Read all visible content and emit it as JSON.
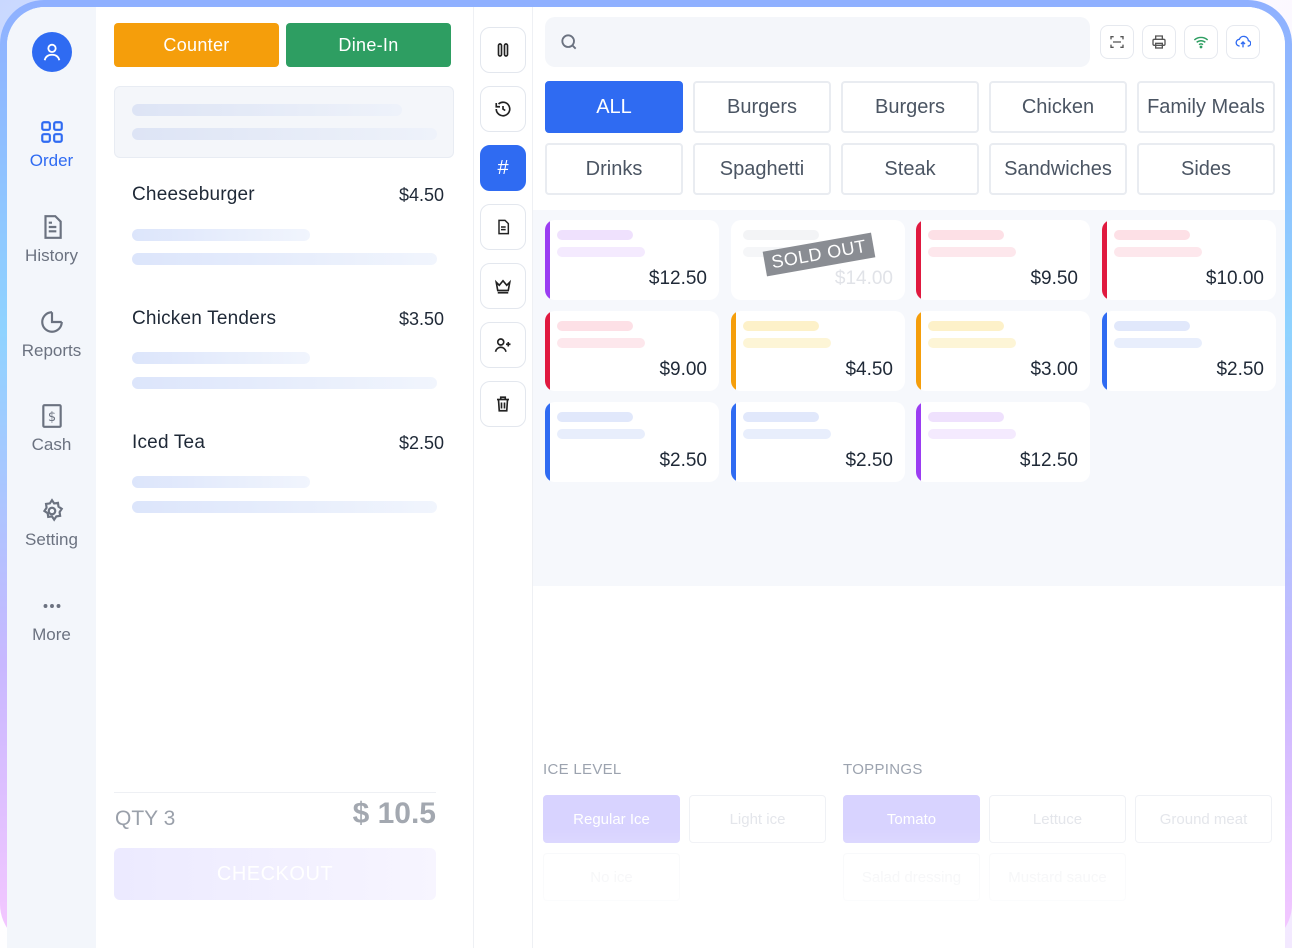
{
  "nav": {
    "items": [
      {
        "label": "Order",
        "icon": "grid-icon",
        "active": true
      },
      {
        "label": "History",
        "icon": "document-icon",
        "active": false
      },
      {
        "label": "Reports",
        "icon": "pie-chart-icon",
        "active": false
      },
      {
        "label": "Cash",
        "icon": "cash-receipt-icon",
        "active": false
      },
      {
        "label": "Setting",
        "icon": "gear-icon",
        "active": false
      },
      {
        "label": "More",
        "icon": "more-dots-icon",
        "active": false
      }
    ]
  },
  "order": {
    "mode_counter": "Counter",
    "mode_dine_in": "Dine-In",
    "items": [
      {
        "name": "Cheeseburger",
        "price": "$4.50"
      },
      {
        "name": "Chicken Tenders",
        "price": "$3.50"
      },
      {
        "name": "Iced Tea",
        "price": "$2.50"
      }
    ],
    "qty_label": "QTY 3",
    "total": "$ 10.5",
    "checkout_label": "CHECKOUT"
  },
  "tools": [
    "pause-icon",
    "history-icon",
    "hash-icon",
    "note-icon",
    "crown-icon",
    "add-user-icon",
    "trash-icon"
  ],
  "search": {
    "placeholder": ""
  },
  "categories": [
    "ALL",
    "Burgers",
    "Burgers",
    "Chicken",
    "Family Meals",
    "Drinks",
    "Spaghetti",
    "Steak",
    "Sandwiches",
    "Sides"
  ],
  "products": [
    {
      "price": "$12.50",
      "color": "#9b3df2",
      "sold_out": false
    },
    {
      "price": "$14.00",
      "color": "#e5e7eb",
      "sold_out": true,
      "sold_out_label": "SOLD OUT"
    },
    {
      "price": "$9.50",
      "color": "#e0193f",
      "sold_out": false
    },
    {
      "price": "$10.00",
      "color": "#e0193f",
      "sold_out": false
    },
    {
      "price": "$9.00",
      "color": "#e0193f",
      "sold_out": false
    },
    {
      "price": "$4.50",
      "color": "#f59e0b",
      "sold_out": false
    },
    {
      "price": "$3.00",
      "color": "#f59e0b",
      "sold_out": false
    },
    {
      "price": "$2.50",
      "color": "#2f6bf2",
      "sold_out": false
    },
    {
      "price": "$2.50",
      "color": "#2f6bf2",
      "sold_out": false
    },
    {
      "price": "$2.50",
      "color": "#2f6bf2",
      "sold_out": false
    },
    {
      "price": "$12.50",
      "color": "#9b3df2",
      "sold_out": false
    }
  ],
  "modifiers": {
    "ice_title": "ICE LEVEL",
    "ice_options": [
      {
        "label": "Regular Ice",
        "selected": true
      },
      {
        "label": "Light ice",
        "selected": false
      },
      {
        "label": "No ice",
        "selected": false
      }
    ],
    "toppings_title": "TOPPINGS",
    "topping_options": [
      {
        "label": "Tomato",
        "selected": true
      },
      {
        "label": "Lettuce",
        "selected": false
      },
      {
        "label": "Ground meat",
        "selected": false
      },
      {
        "label": "Salad dressing",
        "selected": false
      },
      {
        "label": "Mustard sauce",
        "selected": false
      }
    ]
  },
  "colors": {
    "accent": "#2f6bf2",
    "counter": "#f59e0b",
    "dine_in": "#2e9e62"
  }
}
